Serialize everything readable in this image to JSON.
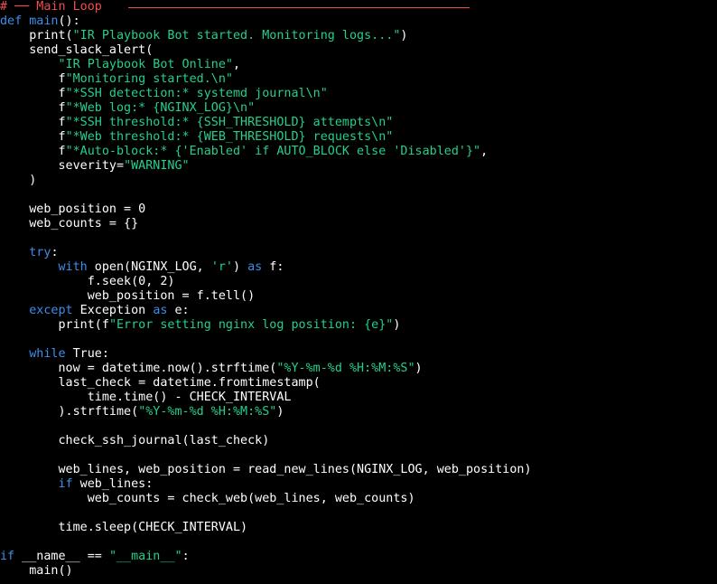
{
  "colors": {
    "background": "#000000",
    "default": "#ffffff",
    "keyword": "#3b8eea",
    "string": "#23d18b",
    "comment": "#f14c4c",
    "constant": "#d670d6"
  },
  "code": {
    "lines": [
      [
        {
          "t": "# ── Main Loop",
          "c": "comment"
        }
      ],
      [
        {
          "t": "def",
          "c": "keyword"
        },
        {
          "t": " ",
          "c": "default"
        },
        {
          "t": "main",
          "c": "func"
        },
        {
          "t": "():",
          "c": "default"
        }
      ],
      [
        {
          "t": "    print(",
          "c": "default"
        },
        {
          "t": "\"IR Playbook Bot started. Monitoring logs...\"",
          "c": "string"
        },
        {
          "t": ")",
          "c": "default"
        }
      ],
      [
        {
          "t": "    send_slack_alert(",
          "c": "default"
        }
      ],
      [
        {
          "t": "        ",
          "c": "default"
        },
        {
          "t": "\"IR Playbook Bot Online\"",
          "c": "string"
        },
        {
          "t": ",",
          "c": "default"
        }
      ],
      [
        {
          "t": "        f",
          "c": "default"
        },
        {
          "t": "\"Monitoring started.\\n\"",
          "c": "string"
        }
      ],
      [
        {
          "t": "        f",
          "c": "default"
        },
        {
          "t": "\"*SSH detection:* systemd journal\\n\"",
          "c": "string"
        }
      ],
      [
        {
          "t": "        f",
          "c": "default"
        },
        {
          "t": "\"*Web log:* {NGINX_LOG}\\n\"",
          "c": "string"
        }
      ],
      [
        {
          "t": "        f",
          "c": "default"
        },
        {
          "t": "\"*SSH threshold:* {SSH_THRESHOLD} attempts\\n\"",
          "c": "string"
        }
      ],
      [
        {
          "t": "        f",
          "c": "default"
        },
        {
          "t": "\"*Web threshold:* {WEB_THRESHOLD} requests\\n\"",
          "c": "string"
        }
      ],
      [
        {
          "t": "        f",
          "c": "default"
        },
        {
          "t": "\"*Auto-block:* {'Enabled' if AUTO_BLOCK else 'Disabled'}\"",
          "c": "string"
        },
        {
          "t": ",",
          "c": "default"
        }
      ],
      [
        {
          "t": "        severity=",
          "c": "default"
        },
        {
          "t": "\"WARNING\"",
          "c": "string"
        }
      ],
      [
        {
          "t": "    )",
          "c": "default"
        }
      ],
      [],
      [
        {
          "t": "    web_position = 0",
          "c": "default"
        }
      ],
      [
        {
          "t": "    web_counts = {}",
          "c": "default"
        }
      ],
      [],
      [
        {
          "t": "    ",
          "c": "default"
        },
        {
          "t": "try",
          "c": "keyword"
        },
        {
          "t": ":",
          "c": "default"
        }
      ],
      [
        {
          "t": "        ",
          "c": "default"
        },
        {
          "t": "with",
          "c": "keyword"
        },
        {
          "t": " open(NGINX_LOG, ",
          "c": "default"
        },
        {
          "t": "'r'",
          "c": "string"
        },
        {
          "t": ") ",
          "c": "default"
        },
        {
          "t": "as",
          "c": "keyword"
        },
        {
          "t": " f:",
          "c": "default"
        }
      ],
      [
        {
          "t": "            f.seek(0, 2)",
          "c": "default"
        }
      ],
      [
        {
          "t": "            web_position = f.tell()",
          "c": "default"
        }
      ],
      [
        {
          "t": "    ",
          "c": "default"
        },
        {
          "t": "except",
          "c": "keyword"
        },
        {
          "t": " Exception ",
          "c": "default"
        },
        {
          "t": "as",
          "c": "keyword"
        },
        {
          "t": " e:",
          "c": "default"
        }
      ],
      [
        {
          "t": "        print(f",
          "c": "default"
        },
        {
          "t": "\"Error setting nginx log position: {e}\"",
          "c": "string"
        },
        {
          "t": ")",
          "c": "default"
        }
      ],
      [],
      [
        {
          "t": "    ",
          "c": "default"
        },
        {
          "t": "while",
          "c": "keyword"
        },
        {
          "t": " ",
          "c": "default"
        },
        {
          "t": "True",
          "c": "constant"
        },
        {
          "t": ":",
          "c": "default"
        }
      ],
      [
        {
          "t": "        now = datetime.now().strftime(",
          "c": "default"
        },
        {
          "t": "\"%Y-%m-%d %H:%M:%S\"",
          "c": "string"
        },
        {
          "t": ")",
          "c": "default"
        }
      ],
      [
        {
          "t": "        last_check = datetime.fromtimestamp(",
          "c": "default"
        }
      ],
      [
        {
          "t": "            time.time() - CHECK_INTERVAL",
          "c": "default"
        }
      ],
      [
        {
          "t": "        ).strftime(",
          "c": "default"
        },
        {
          "t": "\"%Y-%m-%d %H:%M:%S\"",
          "c": "string"
        },
        {
          "t": ")",
          "c": "default"
        }
      ],
      [],
      [
        {
          "t": "        check_ssh_journal(last_check)",
          "c": "default"
        }
      ],
      [],
      [
        {
          "t": "        web_lines, web_position = read_new_lines(NGINX_LOG, web_position)",
          "c": "default"
        }
      ],
      [
        {
          "t": "        ",
          "c": "default"
        },
        {
          "t": "if",
          "c": "keyword"
        },
        {
          "t": " web_lines:",
          "c": "default"
        }
      ],
      [
        {
          "t": "            web_counts = check_web(web_lines, web_counts)",
          "c": "default"
        }
      ],
      [],
      [
        {
          "t": "        time.sleep(CHECK_INTERVAL)",
          "c": "default"
        }
      ],
      [],
      [
        {
          "t": "if",
          "c": "keyword"
        },
        {
          "t": " __name__ == ",
          "c": "default"
        },
        {
          "t": "\"__main__\"",
          "c": "string"
        },
        {
          "t": ":",
          "c": "default"
        }
      ],
      [
        {
          "t": "    main()",
          "c": "default"
        }
      ]
    ]
  }
}
